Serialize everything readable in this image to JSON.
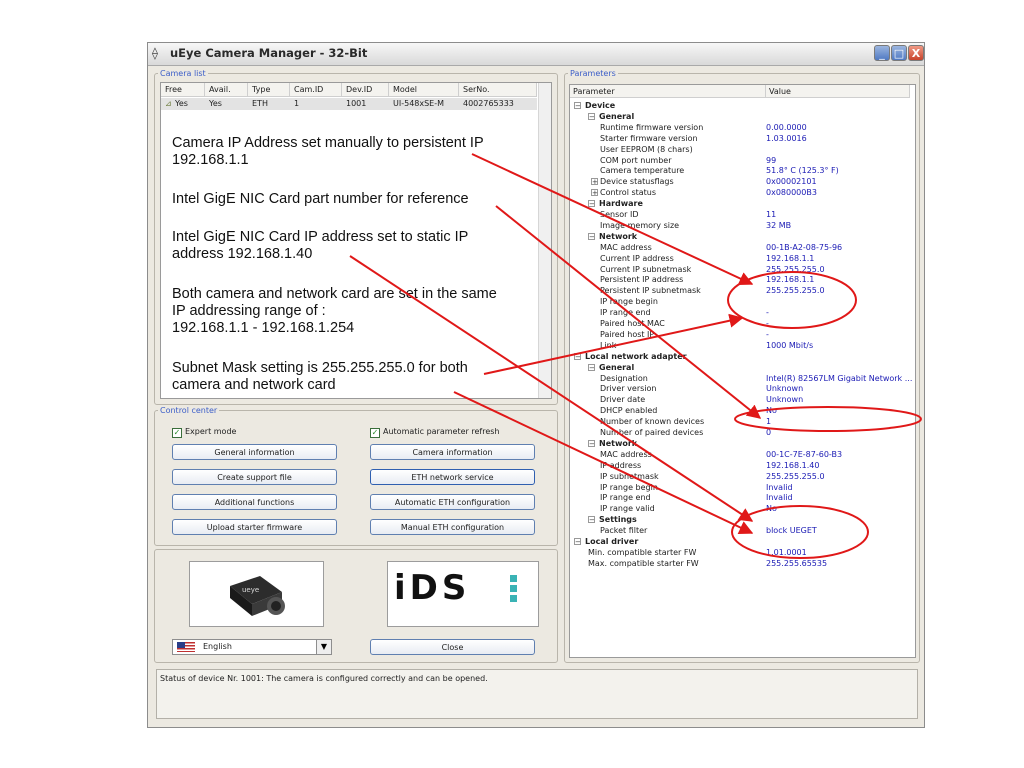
{
  "window": {
    "title": "uEye Camera Manager - 32-Bit",
    "min_label": "_",
    "max_label": "□",
    "close_label": "X"
  },
  "camera_list": {
    "legend": "Camera list",
    "columns": [
      "Free",
      "Avail.",
      "Type",
      "Cam.ID",
      "Dev.ID",
      "Model",
      "SerNo."
    ],
    "row": [
      "Yes",
      "Yes",
      "ETH",
      "1",
      "1001",
      "UI-548xSE-M",
      "4002765333"
    ]
  },
  "annotations": {
    "a1_line1": "Camera IP Address set manually to persistent IP",
    "a1_line2": "192.168.1.1",
    "a2_line1": "Intel GigE NIC Card part number for reference",
    "a3_line1": "Intel GigE NIC Card IP address set to static IP",
    "a3_line2": "address 192.168.1.40",
    "a4_line1": "Both camera and network card are set in the same",
    "a4_line2": "IP addressing range of :",
    "a4_line3": "192.168.1.1  - 192.168.1.254",
    "a5_line1": "Subnet Mask setting is 255.255.255.0 for both",
    "a5_line2": "camera and network card"
  },
  "control_center": {
    "legend": "Control center",
    "expert_mode": "Expert mode",
    "auto_refresh": "Automatic parameter refresh",
    "buttons": {
      "general_info": "General information",
      "camera_info": "Camera information",
      "support_file": "Create support file",
      "eth_service": "ETH network service",
      "additional": "Additional functions",
      "auto_eth": "Automatic ETH configuration",
      "upload_fw": "Upload starter firmware",
      "manual_eth": "Manual ETH configuration"
    }
  },
  "bottom": {
    "language": "English",
    "close": "Close",
    "logo": "iDS"
  },
  "status": {
    "text": "Status of device Nr. 1001: The camera is configured correctly and can be opened."
  },
  "parameters": {
    "legend": "Parameters",
    "col_param": "Parameter",
    "col_value": "Value",
    "rows": [
      {
        "level": 0,
        "toggle": "−",
        "bold": true,
        "name": "Device",
        "value": ""
      },
      {
        "level": 1,
        "toggle": "−",
        "bold": true,
        "name": "General",
        "value": ""
      },
      {
        "level": 2,
        "name": "Runtime firmware version",
        "value": "0.00.0000"
      },
      {
        "level": 2,
        "name": "Starter firmware version",
        "value": "1.03.0016"
      },
      {
        "level": 2,
        "name": "User EEPROM (8 chars)",
        "value": ""
      },
      {
        "level": 2,
        "name": "COM port number",
        "value": "99"
      },
      {
        "level": 2,
        "name": "Camera temperature",
        "value": "51.8° C  (125.3° F)"
      },
      {
        "level": 2,
        "toggle": "+",
        "name": "Device statusflags",
        "value": "0x00002101"
      },
      {
        "level": 2,
        "toggle": "+",
        "name": "Control status",
        "value": "0x080000B3"
      },
      {
        "level": 1,
        "toggle": "−",
        "bold": true,
        "name": "Hardware",
        "value": ""
      },
      {
        "level": 2,
        "name": "Sensor ID",
        "value": "11"
      },
      {
        "level": 2,
        "name": "Image memory size",
        "value": "32 MB"
      },
      {
        "level": 1,
        "toggle": "−",
        "bold": true,
        "name": "Network",
        "value": ""
      },
      {
        "level": 2,
        "name": "MAC address",
        "value": "00-1B-A2-08-75-96"
      },
      {
        "level": 2,
        "name": "Current IP address",
        "value": "192.168.1.1"
      },
      {
        "level": 2,
        "name": "Current IP subnetmask",
        "value": "255.255.255.0"
      },
      {
        "level": 2,
        "name": "Persistent IP address",
        "value": "192.168.1.1"
      },
      {
        "level": 2,
        "name": "Persistent IP subnetmask",
        "value": "255.255.255.0"
      },
      {
        "level": 2,
        "name": "IP range begin",
        "value": ""
      },
      {
        "level": 2,
        "name": "IP range end",
        "value": "-"
      },
      {
        "level": 2,
        "name": "Paired host MAC",
        "value": "-"
      },
      {
        "level": 2,
        "name": "Paired host IP",
        "value": "-"
      },
      {
        "level": 2,
        "name": "Link",
        "value": "1000 Mbit/s"
      },
      {
        "level": 0,
        "toggle": "−",
        "bold": true,
        "name": "Local network adapter",
        "value": ""
      },
      {
        "level": 1,
        "toggle": "−",
        "bold": true,
        "name": "General",
        "value": ""
      },
      {
        "level": 2,
        "name": "Designation",
        "value": "Intel(R) 82567LM Gigabit Network ..."
      },
      {
        "level": 2,
        "name": "Driver version",
        "value": "Unknown"
      },
      {
        "level": 2,
        "name": "Driver date",
        "value": "Unknown"
      },
      {
        "level": 2,
        "name": "DHCP enabled",
        "value": "No"
      },
      {
        "level": 2,
        "name": "Number of known devices",
        "value": "1"
      },
      {
        "level": 2,
        "name": "Number of paired devices",
        "value": "0"
      },
      {
        "level": 1,
        "toggle": "−",
        "bold": true,
        "name": "Network",
        "value": ""
      },
      {
        "level": 2,
        "name": "MAC address",
        "value": "00-1C-7E-87-60-B3"
      },
      {
        "level": 2,
        "name": "IP address",
        "value": "192.168.1.40"
      },
      {
        "level": 2,
        "name": "IP subnetmask",
        "value": "255.255.255.0"
      },
      {
        "level": 2,
        "name": "IP range begin",
        "value": "Invalid"
      },
      {
        "level": 2,
        "name": "IP range end",
        "value": "Invalid"
      },
      {
        "level": 2,
        "name": "IP range valid",
        "value": "No"
      },
      {
        "level": 1,
        "toggle": "−",
        "bold": true,
        "name": "Settings",
        "value": ""
      },
      {
        "level": 2,
        "name": "Packet filter",
        "value": "block UEGET"
      },
      {
        "level": 0,
        "toggle": "−",
        "bold": true,
        "name": "Local driver",
        "value": ""
      },
      {
        "level": 1,
        "name": "Min. compatible starter FW",
        "value": "1.01.0001"
      },
      {
        "level": 1,
        "name": "Max. compatible starter FW",
        "value": "255.255.65535"
      }
    ]
  },
  "colors": {
    "annotation_red": "#e01818",
    "value_blue": "#1a1ab4",
    "legend_blue": "#3c5ec8"
  }
}
